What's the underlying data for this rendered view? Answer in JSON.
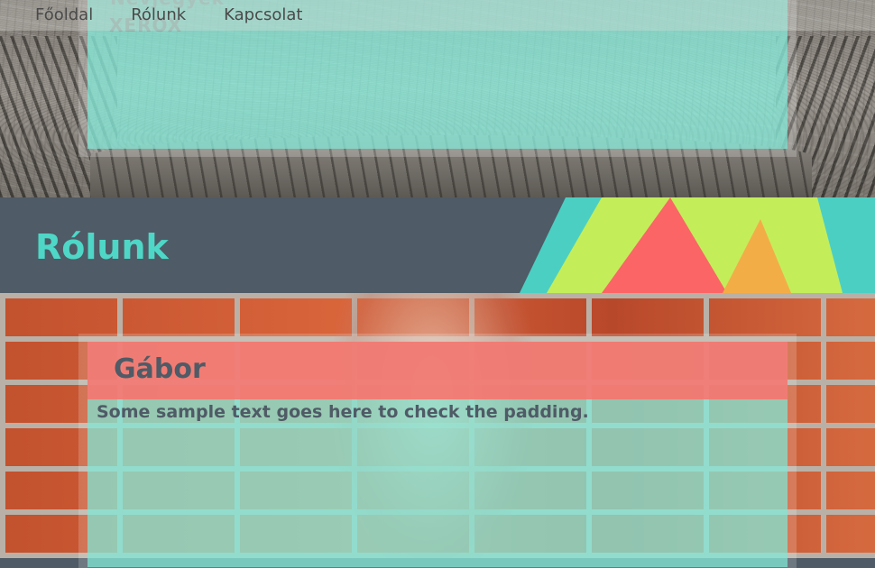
{
  "brand": {
    "line1": "Nevjegyek",
    "line2": "XEROX"
  },
  "nav": {
    "items": [
      {
        "label": "Főoldal"
      },
      {
        "label": "Rólunk"
      },
      {
        "label": "Kapcsolat"
      }
    ]
  },
  "section": {
    "title": "Rólunk"
  },
  "card": {
    "name": "Gábor",
    "text": "Some sample text goes here to check the padding."
  },
  "colors": {
    "band": "#4f5b66",
    "title": "#4ed7c6",
    "panel": "#7ee8d6",
    "name_bar": "#ff6e69",
    "stripe_teal": "#4ccfc3",
    "stripe_lime": "#c3ee5a",
    "stripe_coral": "#fb6565",
    "stripe_orange": "#f3ad47"
  }
}
